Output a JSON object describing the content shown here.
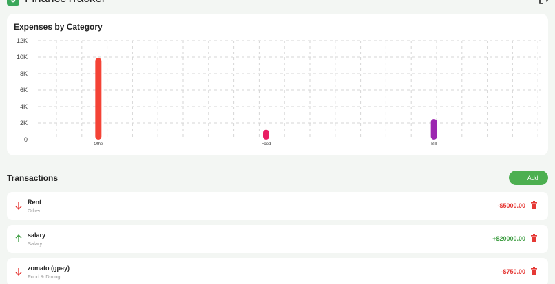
{
  "header": {
    "logo_glyph": "$",
    "app_title": "FinanceTracker",
    "logout_icon": "logout-icon"
  },
  "chart_data": {
    "type": "bar",
    "title": "Expenses by Category",
    "categories": [
      "Othe",
      "Food",
      "Bill"
    ],
    "values": [
      9900,
      1200,
      2500
    ],
    "colors": [
      "#f44336",
      "#e91e63",
      "#9c27b0"
    ],
    "ylim": [
      0,
      12000
    ],
    "yticks": [
      0,
      2000,
      4000,
      6000,
      8000,
      10000,
      12000
    ],
    "ytick_labels": [
      "0",
      "2K",
      "4K",
      "6K",
      "8K",
      "10K",
      "12K"
    ],
    "xlabel": "",
    "ylabel": "",
    "grid": true
  },
  "transactions": {
    "title": "Transactions",
    "add_label": "Add",
    "add_icon": "plus-icon",
    "items": [
      {
        "name": "Rent",
        "category": "Other",
        "amount": "-$5000.00",
        "direction": "down",
        "color": "#e53935"
      },
      {
        "name": "salary",
        "category": "Salary",
        "amount": "+$20000.00",
        "direction": "up",
        "color": "#43a047"
      },
      {
        "name": "zomato (gpay)",
        "category": "Food & Dining",
        "amount": "-$750.00",
        "direction": "down",
        "color": "#e53935"
      }
    ]
  }
}
